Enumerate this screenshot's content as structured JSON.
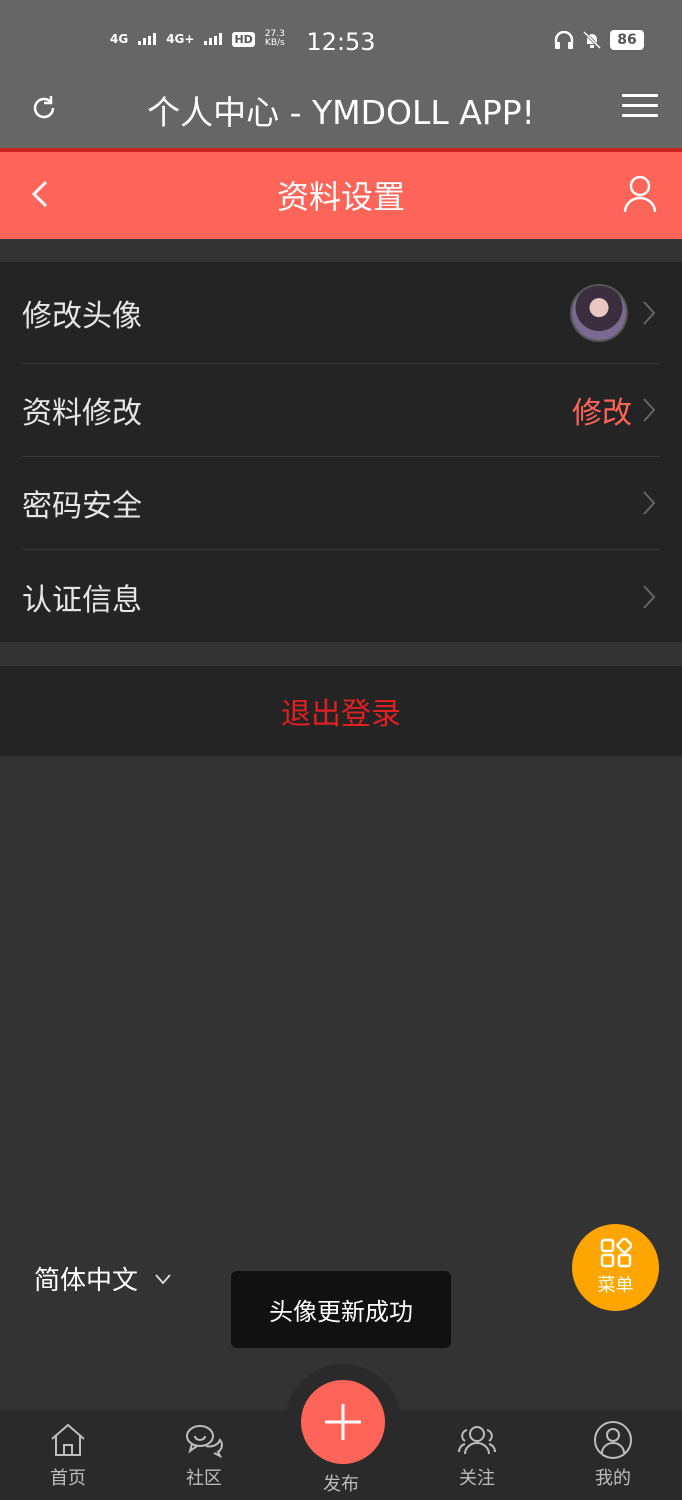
{
  "status_bar": {
    "signal1": "4G",
    "signal2": "4G+",
    "hd": "HD",
    "speed_value": "27.3",
    "speed_unit": "KB/s",
    "time": "12:53",
    "battery": "86"
  },
  "app_header": {
    "title": "个人中心 - YMDOLL APP!"
  },
  "sub_header": {
    "title": "资料设置"
  },
  "settings": {
    "items": [
      {
        "label": "修改头像",
        "value": ""
      },
      {
        "label": "资料修改",
        "value": "修改"
      },
      {
        "label": "密码安全",
        "value": ""
      },
      {
        "label": "认证信息",
        "value": ""
      }
    ]
  },
  "logout_label": "退出登录",
  "language": {
    "selected": "简体中文"
  },
  "toast": "头像更新成功",
  "fab_menu_label": "菜单",
  "bottom_nav": {
    "home": "首页",
    "community": "社区",
    "publish": "发布",
    "follow": "关注",
    "mine": "我的"
  },
  "colors": {
    "accent": "#ff6459",
    "logout": "#e02020",
    "fab": "#ffa500"
  }
}
